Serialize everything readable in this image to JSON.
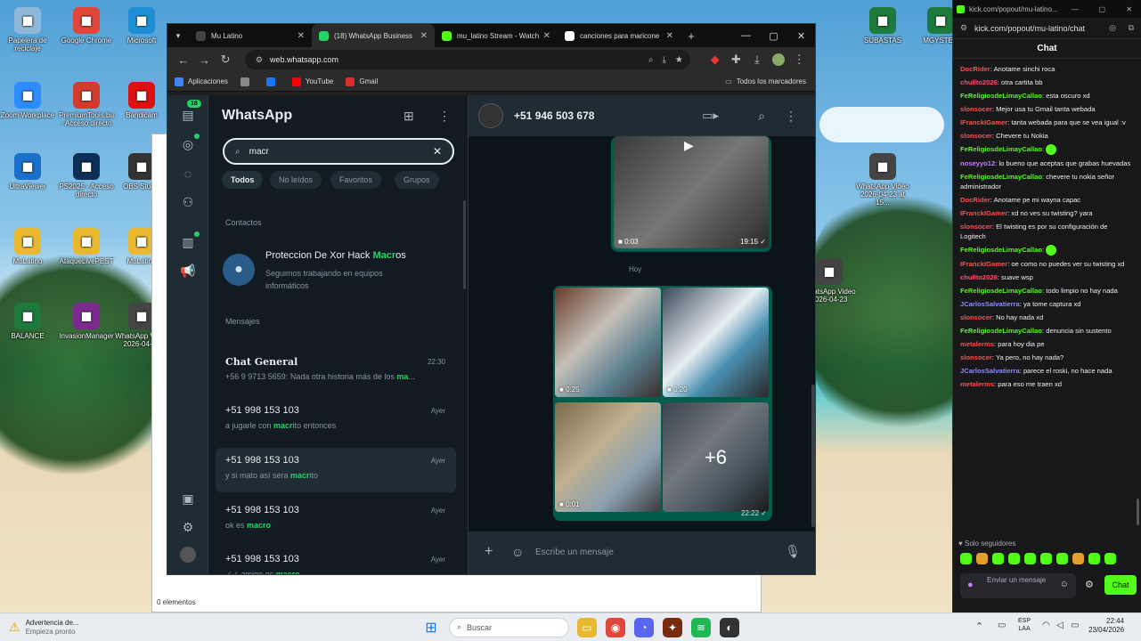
{
  "desktop": {
    "icons": [
      {
        "label": "Papelera de reciclaje",
        "icon": "recycle-bin-icon",
        "color": "#8fb8d8"
      },
      {
        "label": "Google Chrome",
        "icon": "chrome-icon",
        "color": "#e0463a"
      },
      {
        "label": "Microsoft",
        "icon": "edge-icon",
        "color": "#1e8fd6"
      },
      {
        "label": "Zoom Workplace",
        "icon": "zoom-icon",
        "color": "#2d8cff"
      },
      {
        "label": "PremiumTools.bu - Acceso directo",
        "icon": "tools-icon",
        "color": "#d43b2f"
      },
      {
        "label": "Bandicam",
        "icon": "record-icon",
        "color": "#d11"
      },
      {
        "label": "UltraViewer",
        "icon": "monitor-icon",
        "color": "#1a6fc9"
      },
      {
        "label": "PS2025 - Acceso directo",
        "icon": "photoshop-icon",
        "color": "#0c2e57"
      },
      {
        "label": "OBS Studio",
        "icon": "obs-icon",
        "color": "#333"
      },
      {
        "label": "MuLatino",
        "icon": "folder-icon",
        "color": "#e8b830"
      },
      {
        "label": "AtaqueLivePEST",
        "icon": "folder-icon",
        "color": "#e8b830"
      },
      {
        "label": "MuLatino",
        "icon": "folder-icon",
        "color": "#e8b830"
      },
      {
        "label": "BALANCE",
        "icon": "excel-icon",
        "color": "#1d7a3c"
      },
      {
        "label": "InvasionManager",
        "icon": "archive-icon",
        "color": "#7b2b8e"
      },
      {
        "label": "WhatsApp Video 2026-04-23",
        "icon": "video-icon",
        "color": "#444"
      },
      {
        "label": "SUBASTAS",
        "icon": "excel-icon",
        "color": "#1d7a3c"
      },
      {
        "label": "MGYSTER",
        "icon": "excel-icon",
        "color": "#1d7a3c"
      },
      {
        "label": "WhatsApp Video 2026-04-23 at 15...",
        "icon": "video-icon",
        "color": "#444"
      },
      {
        "label": "WhatsApp Video 2026-04-23",
        "icon": "video-icon",
        "color": "#444"
      }
    ]
  },
  "explorer": {
    "status": "0 elementos"
  },
  "browser": {
    "tabs": [
      {
        "label": "Mu Latino",
        "icon": "mu-icon",
        "color": "#444"
      },
      {
        "label": "(18) WhatsApp Business",
        "icon": "whatsapp-icon",
        "color": "#25d366"
      },
      {
        "label": "mu_latino Stream - Watch",
        "icon": "kick-icon",
        "color": "#53fc18"
      },
      {
        "label": "canciones para maricone",
        "icon": "google-icon",
        "color": "#fff"
      }
    ],
    "new_tab": "+",
    "url": "web.whatsapp.com",
    "bookmarks": [
      {
        "label": "Aplicaciones",
        "icon": "apps-icon"
      },
      {
        "label": "",
        "icon": "grid-icon"
      },
      {
        "label": "",
        "icon": "facebook-icon"
      },
      {
        "label": "YouTube",
        "icon": "youtube-icon"
      },
      {
        "label": "Gmail",
        "icon": "gmail-icon"
      }
    ],
    "all_bookmarks": "Todos los marcadores"
  },
  "whatsapp": {
    "unread_badge": "18",
    "title": "WhatsApp",
    "search_value": "macr",
    "filters": [
      "Todos",
      "No leídos",
      "Favoritos",
      "Grupos"
    ],
    "contacts_header": "Contactos",
    "contact": {
      "name_pre": "Proteccion De Xor Hack ",
      "name_hl": "Macr",
      "name_post": "os",
      "status": "Seguimos trabajando en equipos informáticos"
    },
    "messages_header": "Mensajes",
    "results": [
      {
        "name": "Chat General",
        "time": "22:30",
        "pre": "+56 9 9713 5659: Nada otra historia más de los ",
        "hl": "ma",
        "post": "..."
      },
      {
        "name": "+51 998 153 103",
        "time": "Ayer",
        "pre": "a jugarle con ",
        "hl": "macr",
        "post": "ito entonces"
      },
      {
        "name": "+51 998 153 103",
        "time": "Ayer",
        "pre": "y si mato así sera ",
        "hl": "macr",
        "post": "ito"
      },
      {
        "name": "+51 998 153 103",
        "time": "Ayer",
        "pre": "ok es ",
        "hl": "macro",
        "post": ""
      },
      {
        "name": "+51 998 153 103",
        "time": "Ayer",
        "pre": "✓✓ amigo es ",
        "hl": "macro",
        "post": ""
      }
    ],
    "chat": {
      "contact": "+51 946 503 678",
      "video_duration": "0:03",
      "video_time": "19:15",
      "day_divider": "Hoy",
      "album": [
        {
          "duration": "0:25"
        },
        {
          "duration": "0:20"
        },
        {
          "duration": "0:01"
        },
        {
          "duration": "",
          "more": "+6"
        }
      ],
      "album_time": "22:22",
      "input_placeholder": "Escribe un mensaje"
    }
  },
  "kick": {
    "window_url": "kick.com/popout/mu-latino...",
    "url": "kick.com/popout/mu-latino/chat",
    "title": "Chat",
    "messages": [
      {
        "user": "DocRider",
        "color": "#ff4d4d",
        "text": "Anotame sinchi roca"
      },
      {
        "user": "chullto2026",
        "color": "#ff4d6a",
        "text": "otra cartita bb"
      },
      {
        "user": "FeReligiosdeLimayCallao",
        "color": "#53fc18",
        "text": "esta oscuro xd"
      },
      {
        "user": "slonsocer",
        "color": "#ff4d4d",
        "text": "Mejor usa tu Gmail tanta webada"
      },
      {
        "user": "IFranckIGamer",
        "color": "#ff4d4d",
        "text": "tanta webada para que se vea igual :v"
      },
      {
        "user": "slonsocer",
        "color": "#ff4d4d",
        "text": "Chevere tu Nokia"
      },
      {
        "user": "FeReligiosdeLimayCallao",
        "color": "#53fc18",
        "text": ""
      },
      {
        "user": "noseyyo12",
        "color": "#c77dff",
        "text": "lo bueno que aceptas que grabas huevadas"
      },
      {
        "user": "FeReligiosdeLimayCallao",
        "color": "#53fc18",
        "text": "chevere tu nokia señor administrador"
      },
      {
        "user": "DocRider",
        "color": "#ff4d4d",
        "text": "Anotame pe mi wayna capac"
      },
      {
        "user": "IFranckIGamer",
        "color": "#ff4d4d",
        "text": "xd no ves su twisting? yara"
      },
      {
        "user": "slonsocer",
        "color": "#ff4d4d",
        "text": "El twisting es por su configuración de Logitech"
      },
      {
        "user": "FeReligiosdeLimayCallao",
        "color": "#53fc18",
        "text": ""
      },
      {
        "user": "IFranckIGamer",
        "color": "#ff4d4d",
        "text": "oe como no puedes ver su twisting xd"
      },
      {
        "user": "chullto2026",
        "color": "#ff4d6a",
        "text": "suave wsp"
      },
      {
        "user": "FeReligiosdeLimayCallao",
        "color": "#53fc18",
        "text": "todo limpio no hay nada"
      },
      {
        "user": "JCarlosSalvatierra",
        "color": "#8c8cff",
        "text": "ya tome captura xd"
      },
      {
        "user": "slonsocer",
        "color": "#ff4d4d",
        "text": "No hay nada xd"
      },
      {
        "user": "FeReligiosdeLimayCallao",
        "color": "#53fc18",
        "text": "denuncia sin sustento"
      },
      {
        "user": "metalerms",
        "color": "#ff4d4d",
        "text": "para hoy dia pe"
      },
      {
        "user": "slonsocer",
        "color": "#ff4d4d",
        "text": "Ya pero, no hay nada?"
      },
      {
        "user": "JCarlosSalvatierra",
        "color": "#8c8cff",
        "text": "parece el roski, no hace nada"
      },
      {
        "user": "metalerms",
        "color": "#ff4d4d",
        "text": "para eso me traen xd"
      }
    ],
    "followers_only": "Solo seguidores",
    "input_placeholder": "Enviar un mensaje",
    "send_label": "Chat"
  },
  "taskbar": {
    "weather_title": "Advertencia de...",
    "weather_sub": "Empieza pronto",
    "search_placeholder": "Buscar",
    "lang": "ESP",
    "lang_sub": "LAA",
    "time": "22:44",
    "date": "23/04/2026"
  },
  "colors": {
    "wa_accent": "#25d366",
    "kick_accent": "#53fc18",
    "wa_bubble": "#005c4b"
  }
}
